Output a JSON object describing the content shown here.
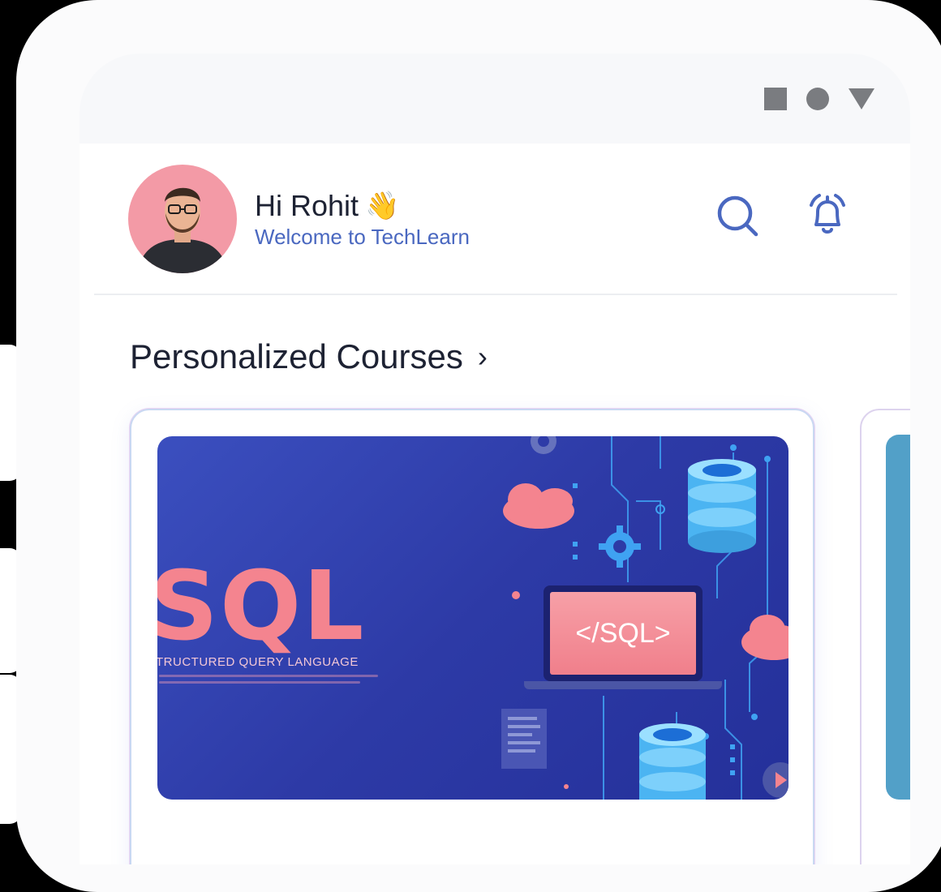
{
  "status_bar": {
    "icons": [
      "square-icon",
      "circle-icon",
      "triangle-icon"
    ]
  },
  "header": {
    "greeting_name": "Hi Rohit",
    "greeting_emoji": "👋",
    "greeting_subtitle": "Welcome to TechLearn",
    "actions": [
      "search-icon",
      "bell-icon"
    ]
  },
  "section": {
    "title": "Personalized Courses",
    "chevron": "›"
  },
  "courses": [
    {
      "headline": "SQL",
      "subtitle": "TRUCTURED QUERY LANGUAGE",
      "screen_text": "</SQL>"
    }
  ],
  "colors": {
    "accent": "#4a68c0",
    "title": "#1d2233",
    "sql_pink": "#f4848f",
    "banner_blue": "#2d3aa6",
    "next_card": "#52a0c8"
  }
}
